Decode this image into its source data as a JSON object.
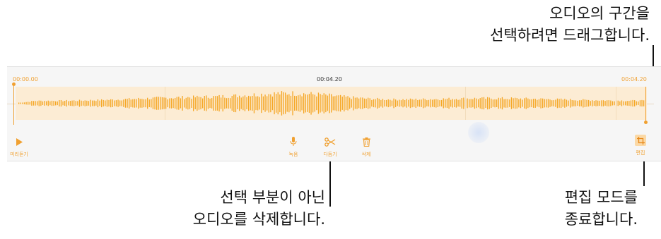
{
  "callouts": {
    "top_line1": "오디오의 구간을",
    "top_line2": "선택하려면 드래그합니다.",
    "bottom_left_line1": "선택 부분이 아닌",
    "bottom_left_line2": "오디오를 삭제합니다.",
    "bottom_right_line1": "편집 모드를",
    "bottom_right_line2": "종료합니다."
  },
  "timeline": {
    "start": "00:00.00",
    "current": "00:04.20",
    "end": "00:04.20"
  },
  "toolbar": {
    "preview_label": "미리듣기",
    "record_label": "녹음",
    "trim_label": "다듬기",
    "delete_label": "삭제",
    "edit_label": "편집"
  },
  "icons": {
    "preview": "play-icon",
    "record": "microphone-icon",
    "trim": "scissors-icon",
    "delete": "trash-icon",
    "edit": "crop-icon"
  },
  "colors": {
    "accent": "#f0a030",
    "waveform": "#f5a623",
    "selection_bg": "#fcecd4",
    "edit_active_bg": "#fbd9a6"
  }
}
